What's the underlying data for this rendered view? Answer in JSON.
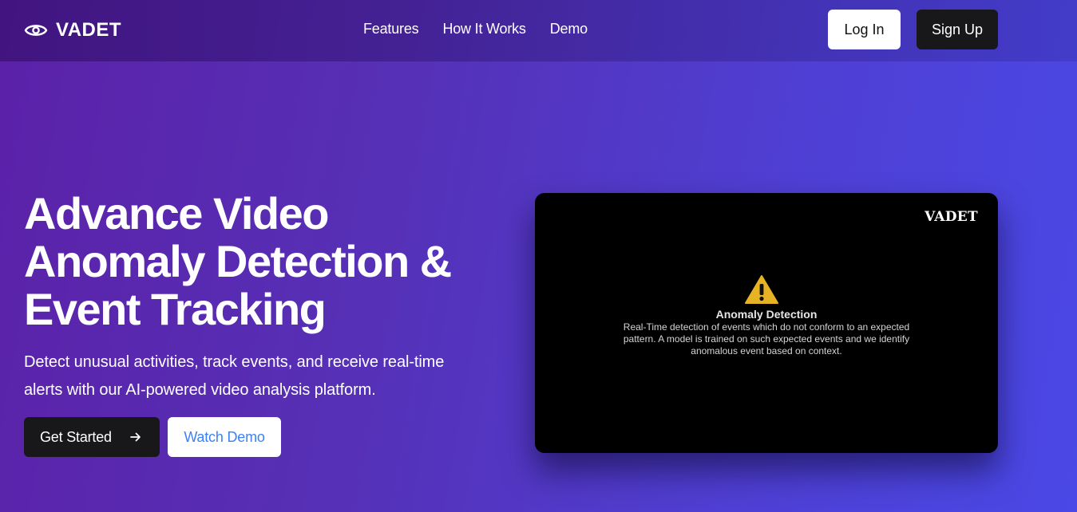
{
  "nav": {
    "brand": "VADET",
    "links": [
      "Features",
      "How It Works",
      "Demo"
    ],
    "login_label": "Log In",
    "signup_label": "Sign Up"
  },
  "hero": {
    "title_lines": [
      "Advance Video",
      "Anomaly Detection &",
      "Event Tracking"
    ],
    "subtitle_lines": [
      "Detect unusual activities, track events, and receive real-time",
      "alerts with our AI-powered video analysis platform."
    ],
    "get_started_label": "Get Started",
    "watch_demo_label": "Watch Demo"
  },
  "video": {
    "brand": "VADET",
    "heading": "Anomaly Detection",
    "description_lines": [
      "Real-Time detection of events which do not conform to an expected",
      "pattern. A model is trained on such expected events and we identify",
      "anomalous event based on context."
    ]
  },
  "colors": {
    "warning": "#e6b325",
    "watch_demo_text": "#3b82f6",
    "dark_button": "#18181b"
  }
}
